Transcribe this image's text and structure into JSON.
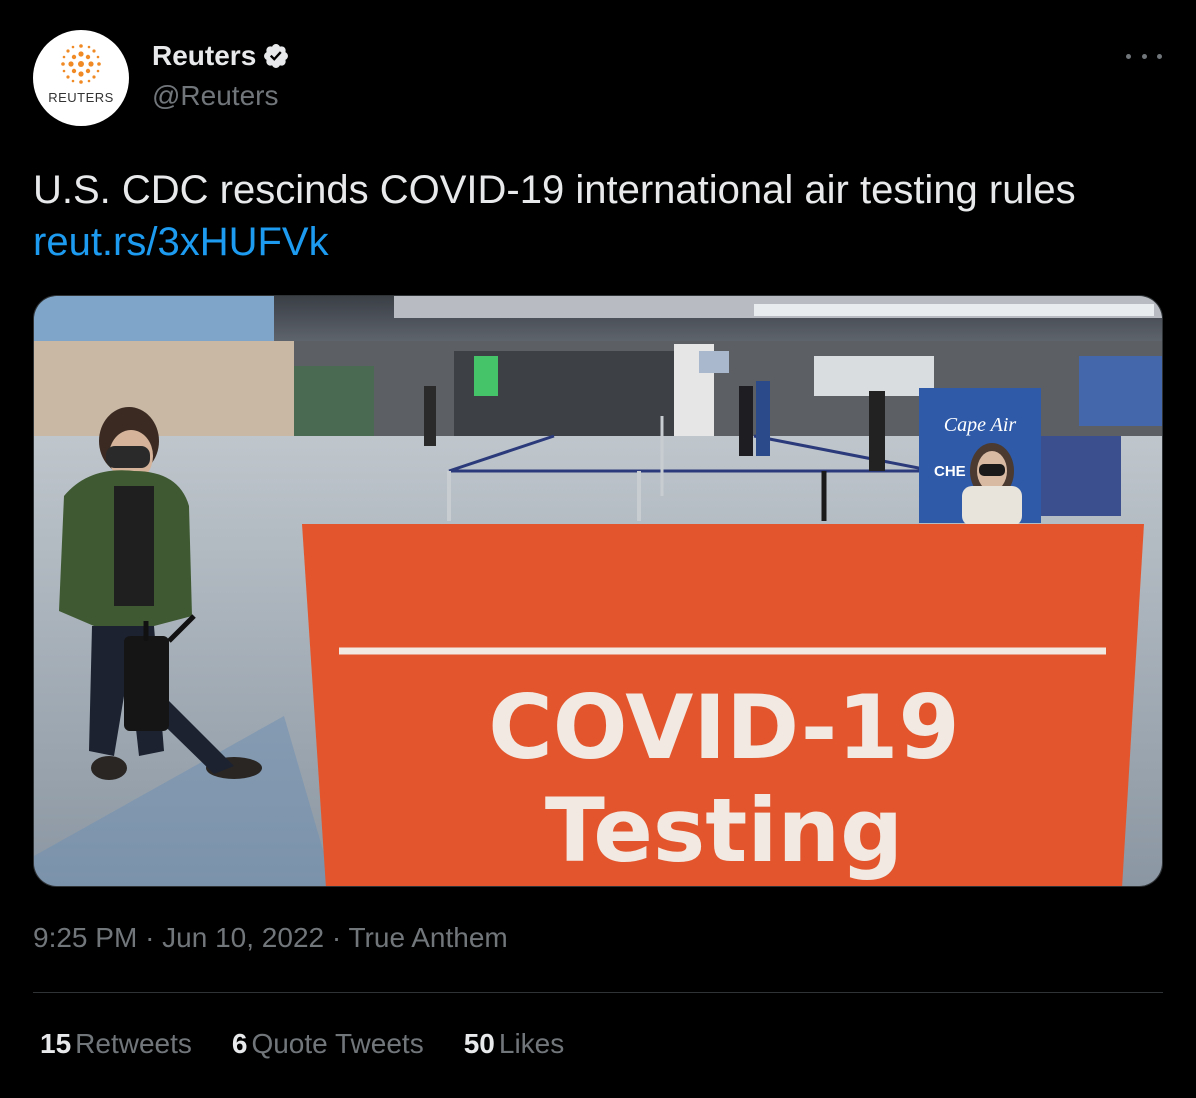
{
  "author": {
    "avatar_text": "REUTERS",
    "name": "Reuters",
    "handle": "@Reuters",
    "verified": true
  },
  "tweet": {
    "text": "U.S. CDC rescinds COVID-19 international air testing rules",
    "link": "reut.rs/3xHUFVk"
  },
  "media": {
    "sign_line1": "COVID-19",
    "sign_line2": "Testing",
    "kiosk_brand": "Cape Air",
    "kiosk_text": "CHE"
  },
  "meta": {
    "time": "9:25 PM",
    "sep1": "·",
    "date": "Jun 10, 2022",
    "sep2": "·",
    "source": "True Anthem"
  },
  "stats": [
    {
      "count": "15",
      "label": "Retweets"
    },
    {
      "count": "6",
      "label": "Quote Tweets"
    },
    {
      "count": "50",
      "label": "Likes"
    }
  ],
  "colors": {
    "background": "#000000",
    "link": "#1d9bf0",
    "muted": "#71767b",
    "verified": "#ffffff",
    "sign_orange": "#e3562d"
  },
  "icons": {
    "verified": "verified-badge-icon",
    "more": "more-dots-icon",
    "logo": "reuters-logo-icon"
  }
}
